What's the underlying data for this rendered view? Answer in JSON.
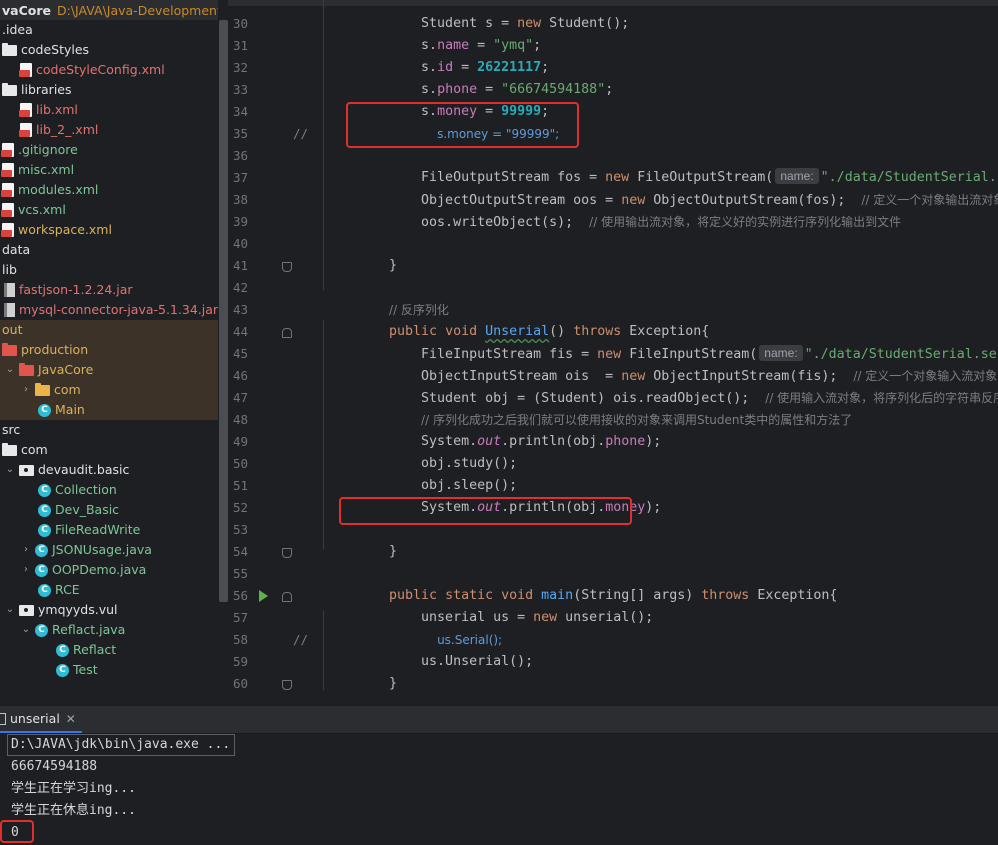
{
  "project": {
    "name": "vaCore",
    "path": "D:\\JAVA\\Java-Development_ar",
    "items": [
      {
        "label": ".idea",
        "icon": "none",
        "color": "white",
        "indent": 2,
        "arrow": ""
      },
      {
        "label": "codeStyles",
        "icon": "folder",
        "color": "white",
        "indent": 2,
        "arrow": ""
      },
      {
        "label": "codeStyleConfig.xml",
        "icon": "xml",
        "color": "red",
        "indent": 20,
        "arrow": ""
      },
      {
        "label": "libraries",
        "icon": "folder",
        "color": "white",
        "indent": 2,
        "arrow": ""
      },
      {
        "label": "lib.xml",
        "icon": "xml",
        "color": "red",
        "indent": 20,
        "arrow": ""
      },
      {
        "label": "lib_2_.xml",
        "icon": "xml",
        "color": "red",
        "indent": 20,
        "arrow": ""
      },
      {
        "label": ".gitignore",
        "icon": "xml",
        "color": "green",
        "indent": 2,
        "arrow": ""
      },
      {
        "label": "misc.xml",
        "icon": "xml",
        "color": "green",
        "indent": 2,
        "arrow": ""
      },
      {
        "label": "modules.xml",
        "icon": "xml",
        "color": "green",
        "indent": 2,
        "arrow": ""
      },
      {
        "label": "vcs.xml",
        "icon": "xml",
        "color": "green",
        "indent": 2,
        "arrow": ""
      },
      {
        "label": "workspace.xml",
        "icon": "xml",
        "color": "yellow",
        "indent": 2,
        "arrow": ""
      },
      {
        "label": "data",
        "icon": "none",
        "color": "white",
        "indent": 2,
        "arrow": ""
      },
      {
        "label": "lib",
        "icon": "none",
        "color": "white",
        "indent": 2,
        "arrow": ""
      },
      {
        "label": "fastjson-1.2.24.jar",
        "icon": "jar",
        "color": "red",
        "indent": 4,
        "arrow": ""
      },
      {
        "label": "mysql-connector-java-5.1.34.jar",
        "icon": "jar",
        "color": "red",
        "indent": 4,
        "arrow": ""
      },
      {
        "label": "out",
        "icon": "none",
        "color": "yellow",
        "indent": 2,
        "arrow": "",
        "hl": true
      },
      {
        "label": "production",
        "icon": "folder-red",
        "color": "yellow",
        "indent": 2,
        "arrow": "",
        "hl": true
      },
      {
        "label": "JavaCore",
        "icon": "folder-red",
        "color": "yellow",
        "indent": 4,
        "arrow": "⌄",
        "hl": true
      },
      {
        "label": "com",
        "icon": "folder-yel",
        "color": "yellow",
        "indent": 20,
        "arrow": "›",
        "hl": true
      },
      {
        "label": "Main",
        "icon": "cls",
        "color": "yellow",
        "indent": 38,
        "arrow": "",
        "hl": true
      },
      {
        "label": "src",
        "icon": "none",
        "color": "white",
        "indent": 2,
        "arrow": ""
      },
      {
        "label": "com",
        "icon": "folder",
        "color": "white",
        "indent": 2,
        "arrow": ""
      },
      {
        "label": "devaudit.basic",
        "icon": "pkg",
        "color": "white",
        "indent": 4,
        "arrow": "⌄"
      },
      {
        "label": "Collection",
        "icon": "cls",
        "color": "green",
        "indent": 38,
        "arrow": ""
      },
      {
        "label": "Dev_Basic",
        "icon": "cls",
        "color": "green",
        "indent": 38,
        "arrow": ""
      },
      {
        "label": "FileReadWrite",
        "icon": "cls",
        "color": "green",
        "indent": 38,
        "arrow": ""
      },
      {
        "label": "JSONUsage.java",
        "icon": "cls",
        "color": "green",
        "indent": 20,
        "arrow": "›"
      },
      {
        "label": "OOPDemo.java",
        "icon": "cls",
        "color": "green",
        "indent": 20,
        "arrow": "›"
      },
      {
        "label": "RCE",
        "icon": "cls",
        "color": "green",
        "indent": 38,
        "arrow": ""
      },
      {
        "label": "ymqyyds.vul",
        "icon": "pkg",
        "color": "white",
        "indent": 4,
        "arrow": "⌄"
      },
      {
        "label": "Reflact.java",
        "icon": "cls",
        "color": "green",
        "indent": 20,
        "arrow": "⌄"
      },
      {
        "label": "Reflact",
        "icon": "cls",
        "color": "green",
        "indent": 56,
        "arrow": ""
      },
      {
        "label": "Test",
        "icon": "cls",
        "color": "green",
        "indent": 56,
        "arrow": ""
      }
    ]
  },
  "editor": {
    "lines": [
      {
        "n": "30",
        "html": "        Student s = <span class='tk-kw'>new</span> Student();"
      },
      {
        "n": "31",
        "html": "        s.<span class='tk-fld'>name</span> = <span class='tk-str'>\"ymq\"</span>;"
      },
      {
        "n": "32",
        "html": "        s.<span class='tk-fld'>id</span> = <span class='tk-num'>26221117</span>;"
      },
      {
        "n": "33",
        "html": "        s.<span class='tk-fld'>phone</span> = <span class='tk-str'>\"66674594188\"</span>;"
      },
      {
        "n": "34",
        "html": "        s.<span class='tk-fld'>money</span> = <span class='tk-num'>99999</span>;"
      },
      {
        "n": "35",
        "html": "          <span class='tk-cmt2'>s.money = \"99999\";</span>",
        "comment": true
      },
      {
        "n": "36",
        "html": ""
      },
      {
        "n": "37",
        "html": "        FileOutputStream fos = <span class='tk-kw'>new</span> FileOutputStream(<span class='hint'>name:</span><span class='tk-str'>\"./data/StudentSerial.ser\"</span>);"
      },
      {
        "n": "38",
        "html": "        ObjectOutputStream oos = <span class='tk-kw'>new</span> ObjectOutputStream(fos);  <span class='tk-cmt'>// 定义一个对象输出流对象，说实</span>"
      },
      {
        "n": "39",
        "html": "        oos.writeObject(s);  <span class='tk-cmt'>// 使用输出流对象，将定义好的实例进行序列化输出到文件</span>"
      },
      {
        "n": "40",
        "html": ""
      },
      {
        "n": "41",
        "html": "    }"
      },
      {
        "n": "42",
        "html": ""
      },
      {
        "n": "43",
        "html": "    <span class='tk-cmt'>// 反序列化</span>"
      },
      {
        "n": "44",
        "html": "    <span class='tk-kw'>public void</span> <span class='tk-fn tk-und'>Unserial</span>() <span class='tk-kw'>throws</span> Exception{"
      },
      {
        "n": "45",
        "html": "        FileInputStream fis = <span class='tk-kw'>new</span> FileInputStream(<span class='hint'>name:</span><span class='tk-str'>\"./data/StudentSerial.ser\"</span>);  <span class='tk-cmt'>//</span>"
      },
      {
        "n": "46",
        "html": "        ObjectInputStream ois  = <span class='tk-kw'>new</span> ObjectInputStream(fis);  <span class='tk-cmt'>// 定义一个对象输入流对象，该对象</span>"
      },
      {
        "n": "47",
        "html": "        Student obj = (Student) ois.readObject();  <span class='tk-cmt'>// 使用输入流对象，将序列化后的字符串反序列化</span>"
      },
      {
        "n": "48",
        "html": "        <span class='tk-cmt'>// 序列化成功之后我们就可以使用接收的对象来调用Student类中的属性和方法了</span>"
      },
      {
        "n": "49",
        "html": "        System.<span class='tk-it'>out</span>.println(obj.<span class='tk-fld'>phone</span>);"
      },
      {
        "n": "50",
        "html": "        obj.study();"
      },
      {
        "n": "51",
        "html": "        obj.sleep();"
      },
      {
        "n": "52",
        "html": "        System.<span class='tk-it'>out</span>.println(obj.<span class='tk-fld'>money</span>);"
      },
      {
        "n": "53",
        "html": ""
      },
      {
        "n": "54",
        "html": "    }"
      },
      {
        "n": "55",
        "html": ""
      },
      {
        "n": "56",
        "html": "    <span class='tk-kw'>public static void</span> <span class='tk-fn'>main</span>(String[] args) <span class='tk-kw'>throws</span> Exception{"
      },
      {
        "n": "57",
        "html": "        unserial us = <span class='tk-kw'>new</span> unserial();"
      },
      {
        "n": "58",
        "html": "          <span class='tk-cmt2'>us.Serial();</span>",
        "comment": true
      },
      {
        "n": "59",
        "html": "        us.Unserial();"
      },
      {
        "n": "60",
        "html": "    }"
      }
    ],
    "comment_mark": "//"
  },
  "run": {
    "tab_label": "unserial",
    "close_glyph": "✕",
    "output": [
      "D:\\JAVA\\jdk\\bin\\java.exe ...",
      "66674594188",
      "学生正在学习ing...",
      "学生正在休息ing...",
      "0"
    ]
  }
}
